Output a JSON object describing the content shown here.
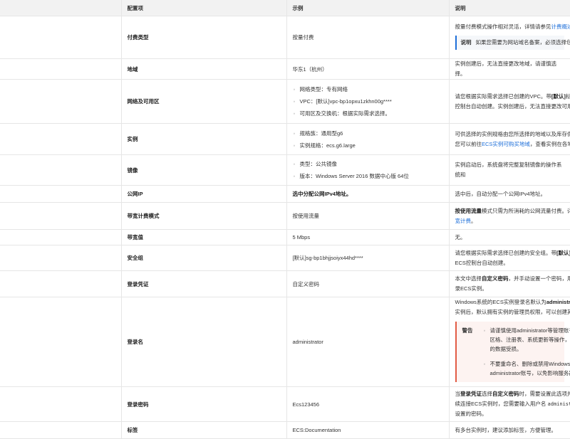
{
  "headers": [
    "配置项",
    "示例",
    "说明"
  ],
  "rows": {
    "pay": {
      "name": "付费类型",
      "example": "按量付费",
      "desc": "按量付费模式操作相对灵活，详情请参见",
      "desc_link": "计费概述",
      "note_label": "说明",
      "note_text": "如果您需要为网站域名备案，必须选择包"
    },
    "region": {
      "name": "地域",
      "example": "华东1（杭州）",
      "desc": "实例创建后，无法直接更改地域，请谨慎选择。"
    },
    "network": {
      "name": "网络及可用区",
      "items": [
        "网络类型：专有网络",
        "VPC：[默认]vpc-bp1opxu1zkhn00g****",
        "可用区及交换机：根据实际需求选择。"
      ],
      "desc1": "请您根据实际需求选择已创建的VPC。带",
      "desc_bold": "[默认]",
      "desc2": "标识",
      "desc3": "控制台自动创建。实例创建后，无法直接更改可用区"
    },
    "instance": {
      "name": "实例",
      "items": [
        "规格族：通用型g6",
        "实例规格：ecs.g6.large"
      ],
      "desc1": "可供选择的实例规格由您所选择的地域以及库存供",
      "desc2": "您可以前往",
      "desc_link": "ECS实例可购买地域",
      "desc3": "，查看实例在各地"
    },
    "image": {
      "name": "镜像",
      "items": [
        "类型：公共镜像",
        "版本：Windows Server 2016 数据中心版 64位"
      ],
      "desc": "实例启动后，系统盘将完整复制镜像的操作系统和"
    },
    "ip": {
      "name": "公网IP",
      "example": "选中分配公网IPv4地址。",
      "desc": "选中后，自动分配一个公网IPv4地址。"
    },
    "bw_mode": {
      "name": "带宽计费模式",
      "example": "按使用流量",
      "desc_bold": "按使用流量",
      "desc1": "模式只需为所消耗的公网流量付费。详",
      "desc_link": "宽计费",
      "desc2": "。"
    },
    "bw": {
      "name": "带宽值",
      "example": "5 Mbps",
      "desc": "无。"
    },
    "sg": {
      "name": "安全组",
      "example": "[默认]sg-bp1bhjjsoiyx44hd****",
      "desc1": "请您根据实际需求选择已创建的安全组。带",
      "desc_bold": "[默认]",
      "desc2": "ECS控制台自动创建。"
    },
    "cred": {
      "name": "登录凭证",
      "example": "自定义密码",
      "desc1": "本文中选择",
      "desc_bold": "自定义密码",
      "desc2": "，并手动设置一个密码，用",
      "desc3": "录ECS实例。"
    },
    "login": {
      "name": "登录名",
      "example": "administrator",
      "desc1": "Windows系统的ECS实例登录名默认为",
      "desc_bold": "administra",
      "desc2": "实例后，默认拥有实例的管理员权限，可以创建其",
      "warn_label": "警告",
      "warn_items": [
        "请谨慎使用administrator等管理账号",
        "不要重命名、删除或禁用Windows下"
      ],
      "warn_sub": [
        "区格、注册表、系统更新等操作，避",
        "的数据受损。",
        "administrator账号，以免影响服务器"
      ]
    },
    "pwd": {
      "name": "登录密码",
      "example": "Ecs123456",
      "desc1": "当",
      "desc_bold1": "登录凭证",
      "desc2": "选择",
      "desc_bold2": "自定义密码",
      "desc3": "时，需要设置此选项并",
      "desc4": "续连接ECS实例时，您需要输入用户名",
      "desc_mono": "administ",
      "desc5": "设置的密码。"
    },
    "tag": {
      "name": "标签",
      "example": "ECS:Documentation",
      "desc": "有多台实例时，建议添加标签，方便管理。"
    }
  }
}
